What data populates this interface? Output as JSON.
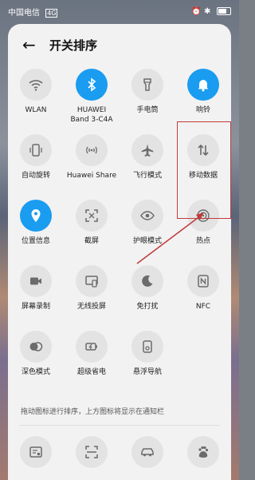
{
  "status_bar": {
    "carrier": "中国电信",
    "network": "4G",
    "time": ""
  },
  "header": {
    "title": "开关排序"
  },
  "tiles": [
    {
      "label": "WLAN",
      "icon": "wifi-icon",
      "on": false
    },
    {
      "label": "HUAWEI\nBand 3-C4A",
      "icon": "bluetooth-icon",
      "on": true
    },
    {
      "label": "手电筒",
      "icon": "flashlight-icon",
      "on": false
    },
    {
      "label": "响铃",
      "icon": "bell-icon",
      "on": true
    },
    {
      "label": "自动旋转",
      "icon": "auto-rotate-icon",
      "on": false
    },
    {
      "label": "Huawei Share",
      "icon": "huawei-share-icon",
      "on": false
    },
    {
      "label": "飞行模式",
      "icon": "airplane-icon",
      "on": false
    },
    {
      "label": "移动数据",
      "icon": "mobile-data-icon",
      "on": false
    },
    {
      "label": "位置信息",
      "icon": "location-icon",
      "on": true
    },
    {
      "label": "截屏",
      "icon": "screenshot-icon",
      "on": false
    },
    {
      "label": "护眼模式",
      "icon": "eye-comfort-icon",
      "on": false
    },
    {
      "label": "热点",
      "icon": "hotspot-icon",
      "on": false
    },
    {
      "label": "屏幕录制",
      "icon": "screen-record-icon",
      "on": false
    },
    {
      "label": "无线投屏",
      "icon": "wireless-projection-icon",
      "on": false
    },
    {
      "label": "免打扰",
      "icon": "do-not-disturb-icon",
      "on": false
    },
    {
      "label": "NFC",
      "icon": "nfc-icon",
      "on": false
    },
    {
      "label": "深色模式",
      "icon": "dark-mode-icon",
      "on": false
    },
    {
      "label": "超级省电",
      "icon": "ultra-power-saving-icon",
      "on": false
    },
    {
      "label": "悬浮导航",
      "icon": "floating-navigation-icon",
      "on": false
    }
  ],
  "hint": "拖动图标进行排序，上方图标将显示在通知栏",
  "bottom_icons": [
    "card-icon",
    "scan-icon",
    "car-icon",
    "baidu-icon"
  ],
  "colors": {
    "accent": "#1a9cf0",
    "annotation": "#c23a3a"
  }
}
